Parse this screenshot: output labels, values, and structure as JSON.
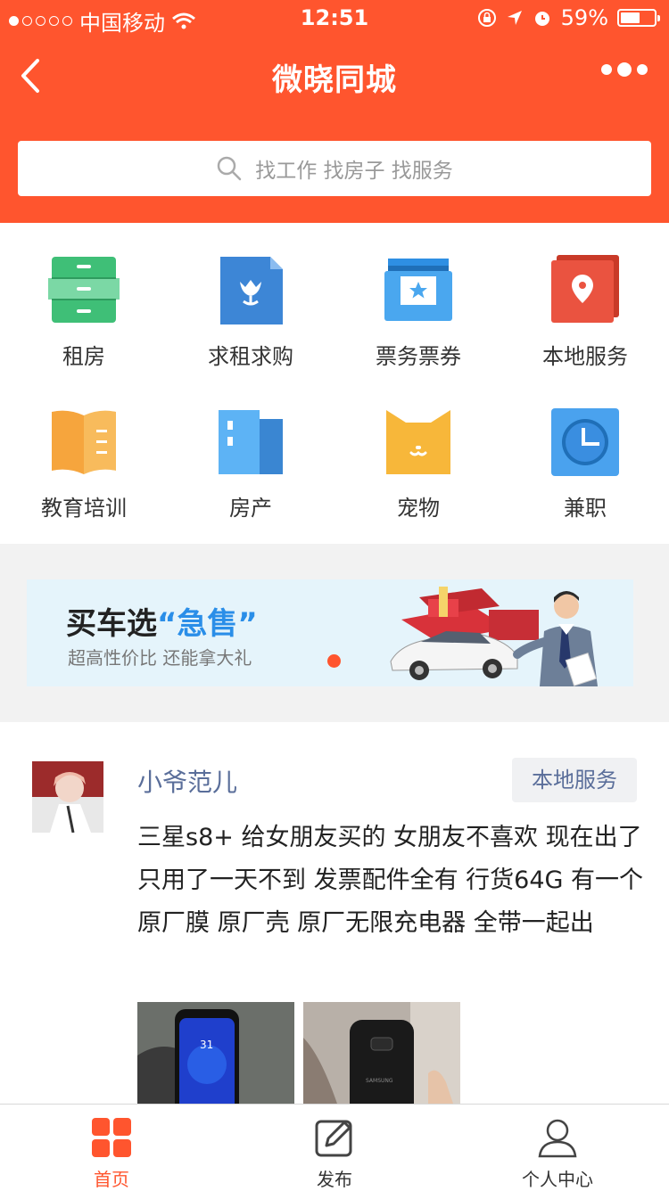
{
  "status_bar": {
    "carrier": "中国移动",
    "time": "12:51",
    "battery": "59%",
    "battery_level": 0.59
  },
  "navbar": {
    "title": "微晓同城",
    "back_icon": "chevron-left-icon",
    "more_icon": "more-dots-icon"
  },
  "search": {
    "placeholder": "找工作 找房子 找服务",
    "icon": "search-icon"
  },
  "categories": [
    {
      "label": "租房",
      "icon": "drawer-cabinet-icon",
      "color": "#3fbf77"
    },
    {
      "label": "求租求购",
      "icon": "tulip-document-icon",
      "color": "#3d86d6"
    },
    {
      "label": "票务票券",
      "icon": "ticket-star-icon",
      "color": "#2e8fe3"
    },
    {
      "label": "本地服务",
      "icon": "map-pin-icon",
      "color": "#ea5340"
    },
    {
      "label": "教育培训",
      "icon": "open-book-icon",
      "color": "#f6a53d"
    },
    {
      "label": "房产",
      "icon": "building-icon",
      "color": "#4aa7ef"
    },
    {
      "label": "宠物",
      "icon": "cat-face-icon",
      "color": "#f7b73a"
    },
    {
      "label": "兼职",
      "icon": "clock-icon",
      "color": "#4aa2ee"
    }
  ],
  "banner": {
    "title_prefix": "买车选",
    "title_quote": "“急售”",
    "subtitle": "超高性价比 还能拿大礼"
  },
  "post": {
    "author": "小爷范儿",
    "tag": "本地服务",
    "content": "三星s8+ 给女朋友买的 女朋友不喜欢 现在出了只用了一天不到 发票配件全有 行货64G 有一个原厂膜 原厂壳 原厂无限充电器 全带一起出"
  },
  "tabbar": [
    {
      "label": "首页",
      "icon": "home-grid-icon",
      "active": true
    },
    {
      "label": "发布",
      "icon": "edit-icon",
      "active": false
    },
    {
      "label": "个人中心",
      "icon": "user-icon",
      "active": false
    }
  ],
  "colors": {
    "brand": "#ff552e",
    "link": "#5a6e9a"
  }
}
